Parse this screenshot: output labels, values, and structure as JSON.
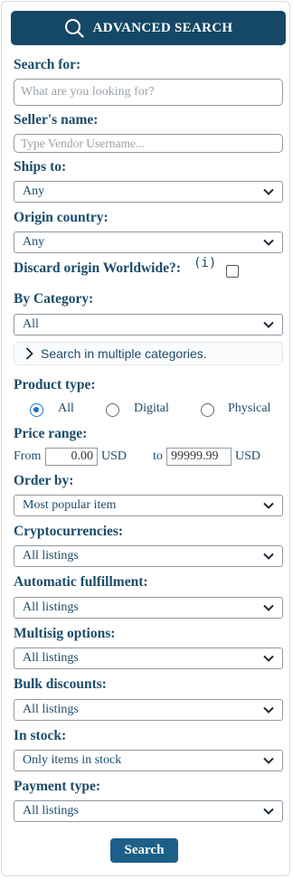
{
  "header": {
    "title": "ADVANCED SEARCH",
    "icon": "search-icon"
  },
  "search_for": {
    "label": "Search for:",
    "placeholder": "What are you looking for?",
    "value": ""
  },
  "seller_name": {
    "label": "Seller's name:",
    "placeholder": "Type Vendor Username...",
    "value": ""
  },
  "ships_to": {
    "label": "Ships to:",
    "value": "Any"
  },
  "origin_country": {
    "label": "Origin country:",
    "value": "Any"
  },
  "discard_origin": {
    "label": "Discard origin Worldwide?:",
    "info": "(i)",
    "checked": false
  },
  "category": {
    "label": "By Category:",
    "value": "All",
    "multi_label": "Search in multiple categories."
  },
  "product_type": {
    "label": "Product type:",
    "options": [
      {
        "label": "All",
        "checked": true
      },
      {
        "label": "Digital",
        "checked": false
      },
      {
        "label": "Physical",
        "checked": false
      }
    ]
  },
  "price_range": {
    "label": "Price range:",
    "from_label": "From",
    "from_value": "0.00",
    "from_currency": "USD",
    "to_label": "to",
    "to_value": "99999.99",
    "to_currency": "USD"
  },
  "order_by": {
    "label": "Order by:",
    "value": "Most popular item"
  },
  "cryptocurrencies": {
    "label": "Cryptocurrencies:",
    "value": "All listings"
  },
  "auto_fulfillment": {
    "label": "Automatic fulfillment:",
    "value": "All listings"
  },
  "multisig": {
    "label": "Multisig options:",
    "value": "All listings"
  },
  "bulk_discounts": {
    "label": "Bulk discounts:",
    "value": "All listings"
  },
  "in_stock": {
    "label": "In stock:",
    "value": "Only items in stock"
  },
  "payment_type": {
    "label": "Payment type:",
    "value": "All listings"
  },
  "search_button": {
    "label": "Search"
  },
  "colors": {
    "header_bg": "#144866",
    "text": "#1b4c6b",
    "button_bg": "#1d5f88",
    "radio_accent": "#1a73c9"
  }
}
